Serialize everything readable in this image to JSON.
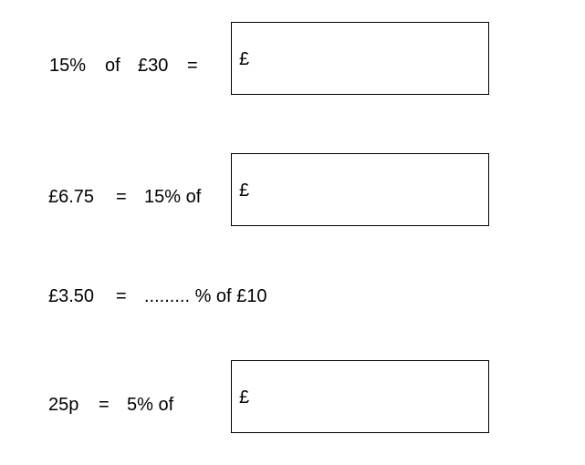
{
  "questions": [
    {
      "parts": [
        "15%",
        "of",
        "£30",
        "="
      ],
      "answer_prefix": "£"
    },
    {
      "parts": [
        "£6.75",
        "=",
        "15% of"
      ],
      "answer_prefix": "£"
    },
    {
      "parts": [
        "£3.50",
        "=",
        "......... % of £10"
      ]
    },
    {
      "parts": [
        "25p",
        "=",
        "5% of"
      ],
      "answer_prefix": "£"
    }
  ]
}
